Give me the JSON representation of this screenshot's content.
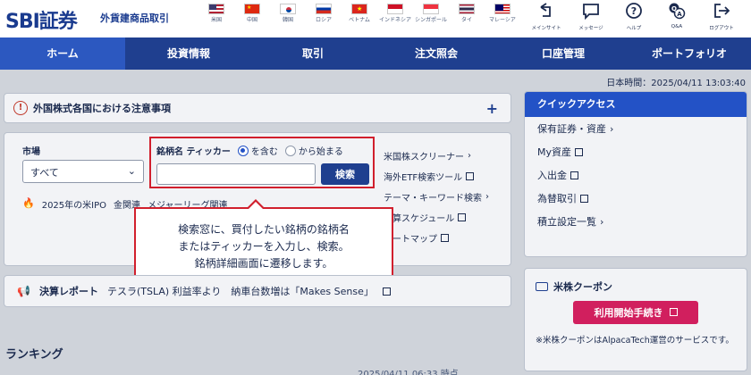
{
  "brand": {
    "logo": "SBI証券",
    "subtitle": "外貨建商品取引"
  },
  "flags": [
    {
      "label": "米国",
      "icon": "us-flag-icon"
    },
    {
      "label": "中国",
      "icon": "china-flag-icon"
    },
    {
      "label": "韓国",
      "icon": "korea-flag-icon"
    },
    {
      "label": "ロシア",
      "icon": "russia-flag-icon"
    },
    {
      "label": "ベトナム",
      "icon": "vietnam-flag-icon"
    },
    {
      "label": "インドネシア",
      "icon": "indonesia-flag-icon"
    },
    {
      "label": "シンガポール",
      "icon": "singapore-flag-icon"
    },
    {
      "label": "タイ",
      "icon": "thailand-flag-icon"
    },
    {
      "label": "マレーシア",
      "icon": "malaysia-flag-icon"
    }
  ],
  "utility": [
    {
      "label": "メインサイト",
      "icon": "main-site-icon"
    },
    {
      "label": "メッセージ",
      "icon": "message-icon"
    },
    {
      "label": "ヘルプ",
      "icon": "help-icon"
    },
    {
      "label": "Q&A",
      "icon": "qa-icon"
    },
    {
      "label": "ログアウト",
      "icon": "logout-icon"
    }
  ],
  "nav": [
    "ホーム",
    "投資情報",
    "取引",
    "注文照会",
    "口座管理",
    "ポートフォリオ"
  ],
  "timestamp": "日本時間：2025/04/11 13:03:40",
  "notice": {
    "title": "外国株式各国における注意事項"
  },
  "search": {
    "market_label": "市場",
    "market_value": "すべて",
    "field_label": "銘柄名 ティッカー",
    "radio_contains": "を含む",
    "radio_starts": "から始まる",
    "button": "検索"
  },
  "ipo_line": [
    "2025年の米IPO",
    "金関連",
    "メジャーリーグ関連"
  ],
  "links": [
    "米国株スクリーナー",
    "海外ETF検索ツール",
    "テーマ・キーワード検索",
    "決算スケジュール",
    "ヒートマップ"
  ],
  "tooltip": [
    "検索窓に、買付したい銘柄の銘柄名",
    "またはティッカーを入力し、検索。",
    "銘柄詳細画面に遷移します。"
  ],
  "earnings": {
    "label": "決算レポート",
    "text": "テスラ(TSLA) 利益率より　納車台数増は「Makes Sense」"
  },
  "ranking": {
    "title": "ランキング",
    "time": "2025/04/11 06:33 時点"
  },
  "quick": {
    "title": "クイックアクセス",
    "items": [
      "保有証券・資産",
      "My資産",
      "入出金",
      "為替取引",
      "積立設定一覧"
    ]
  },
  "coupon": {
    "title": "米株クーポン",
    "button": "利用開始手続き",
    "note": "※米株クーポンはAlpacaTech運営のサービスです。"
  },
  "colors": {
    "navy": "#1f3f8f",
    "accent_red": "#d11f2d",
    "coupon_pink": "#d11f5e",
    "quick_blue": "#2352c6"
  }
}
